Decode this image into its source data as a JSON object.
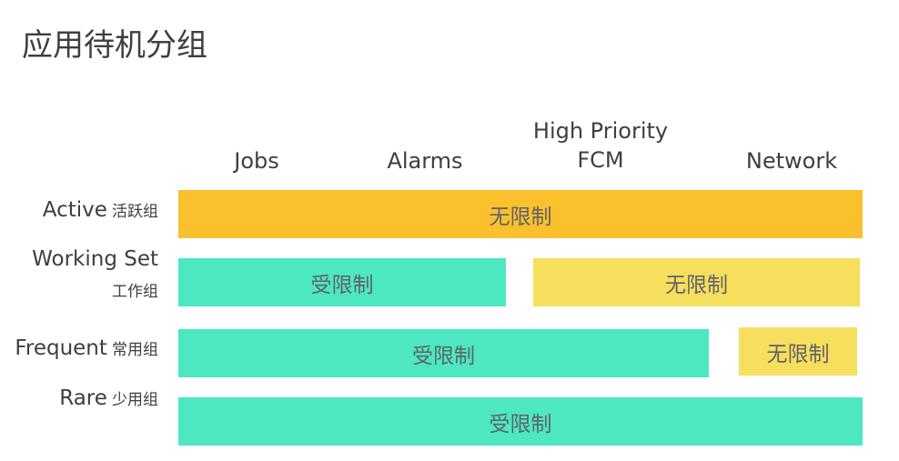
{
  "title": "应用待机分组",
  "columns": {
    "jobs": "Jobs",
    "alarms": "Alarms",
    "fcm_line1": "High Priority",
    "fcm_line2": "FCM",
    "network": "Network"
  },
  "rows": {
    "active": {
      "en": "Active",
      "zh": "活跃组"
    },
    "working_set": {
      "en": "Working Set",
      "zh": "工作组"
    },
    "frequent": {
      "en": "Frequent",
      "zh": "常用组"
    },
    "rare": {
      "en": "Rare",
      "zh": "少用组"
    }
  },
  "bars": {
    "active_all": "无限制",
    "working_restricted": "受限制",
    "working_unrestricted": "无限制",
    "frequent_restricted": "受限制",
    "frequent_unrestricted": "无限制",
    "rare_all": "受限制"
  },
  "colors": {
    "active_orange": "#fbc02d",
    "restricted_teal": "#4de8c2",
    "unrestricted_yellow": "#f7df5e",
    "text": "#3c4043"
  }
}
